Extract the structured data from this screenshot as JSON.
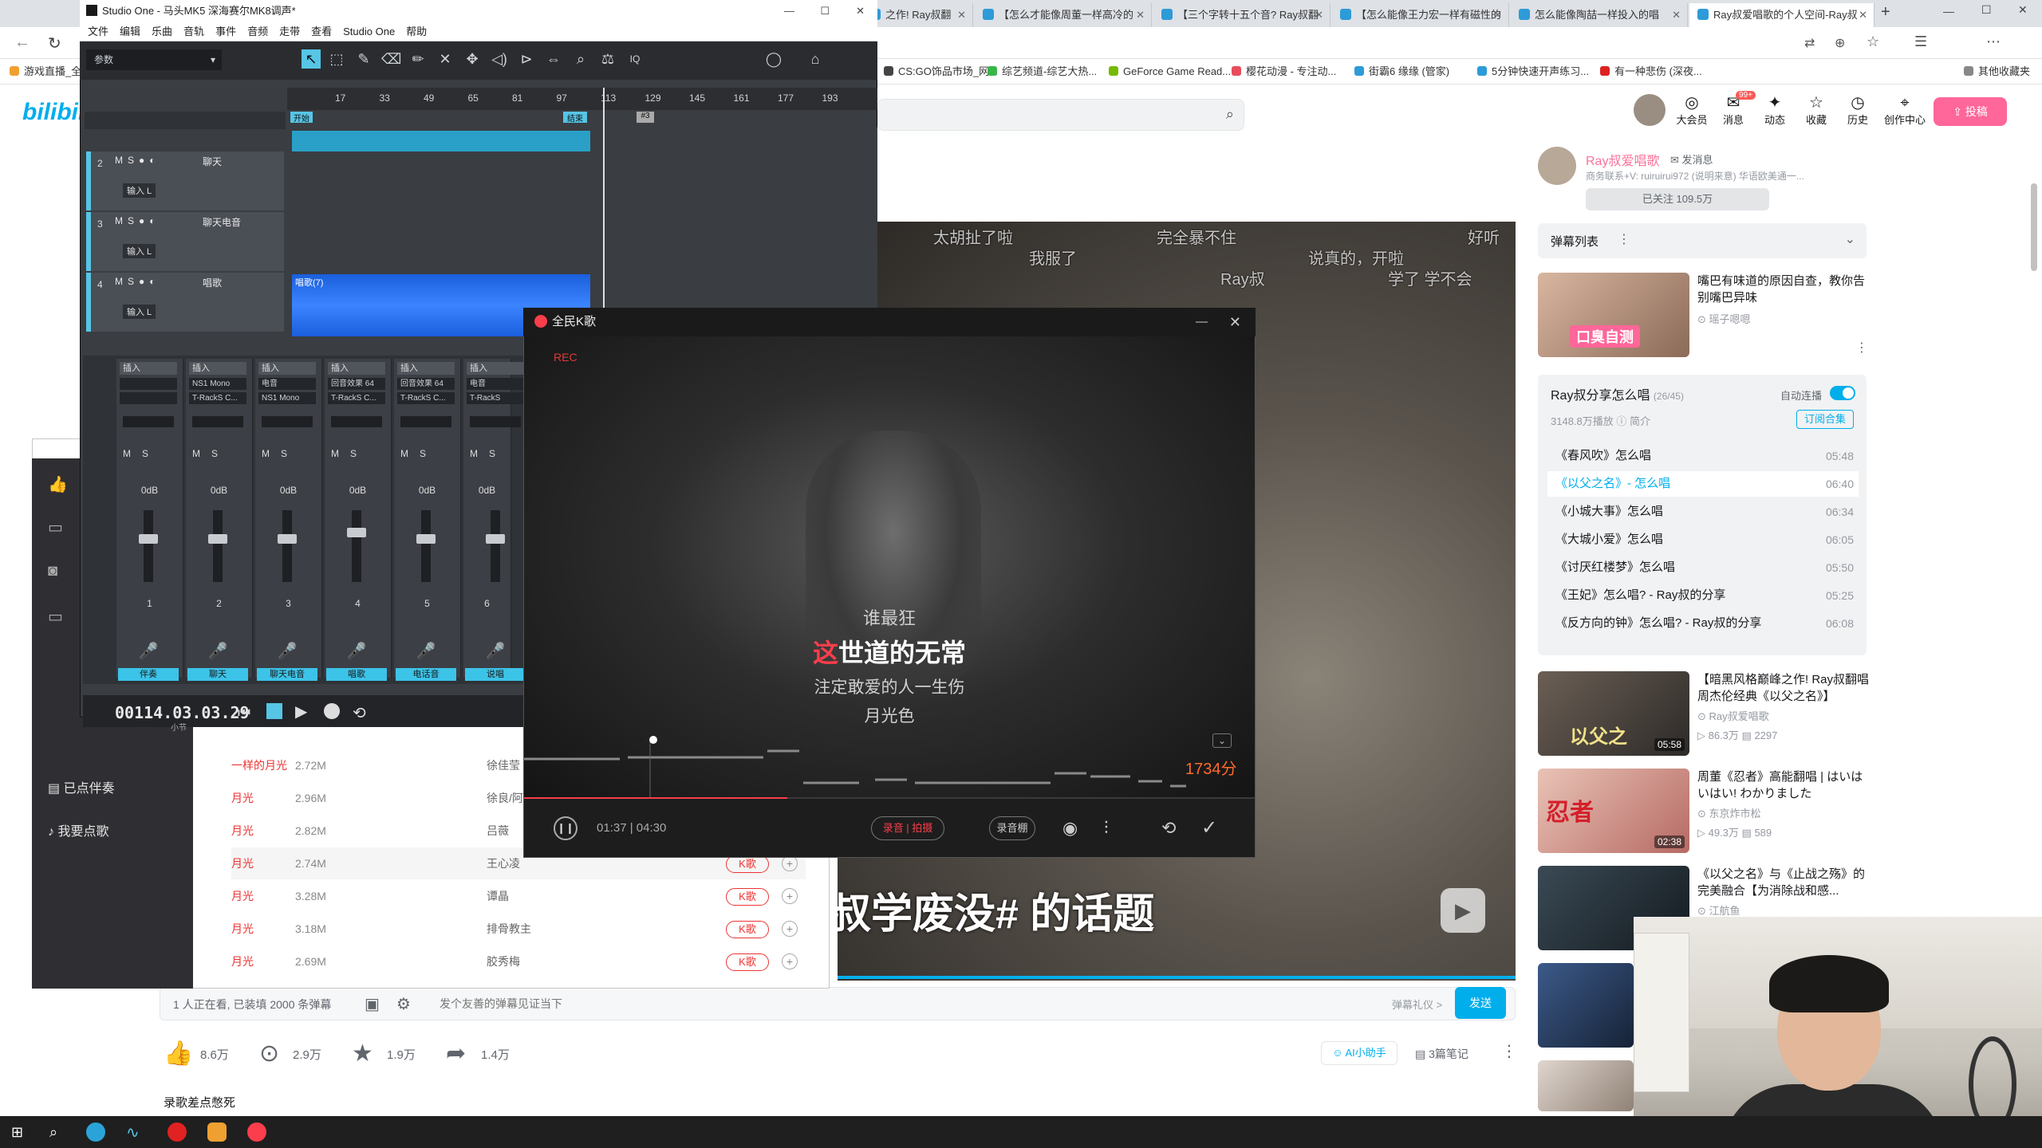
{
  "browser": {
    "tabs": [
      {
        "title": "之作! Ray叔翻"
      },
      {
        "title": "【怎么才能像周董一样高冷的"
      },
      {
        "title": "【三个字转十五个音? Ray叔翻"
      },
      {
        "title": "【怎么能像王力宏一样有磁性的"
      },
      {
        "title": "怎么能像陶喆一样投入的唱"
      },
      {
        "title": "Ray叔爱唱歌的个人空间-Ray叔"
      }
    ],
    "bookmarks": [
      "游戏直播_全",
      "CS:GO饰品市场_网...",
      "综艺频道-综艺大热...",
      "GeForce Game Read...",
      "樱花动漫 - 专注动...",
      "街霸6 缘缘 (管家)",
      "5分钟快速开声练习...",
      "有一种悲伤 (深夜...",
      "其他收藏夹"
    ]
  },
  "bilibili": {
    "logo": "bilibili",
    "header_icons": [
      {
        "label": "大会员",
        "glyph": "◎"
      },
      {
        "label": "消息",
        "glyph": "✉",
        "badge": "99+"
      },
      {
        "label": "动态",
        "glyph": "✦"
      },
      {
        "label": "收藏",
        "glyph": "☆"
      },
      {
        "label": "历史",
        "glyph": "◷"
      },
      {
        "label": "创作中心",
        "glyph": "⌖"
      }
    ],
    "upload_label": "投稿",
    "up": {
      "name": "Ray叔爱唱歌",
      "message": "发消息",
      "desc": "商务联系+V: ruiruirui972 (说明来意) 华语欧美通一...",
      "follow": "已关注 109.5万"
    },
    "danmaku_list_label": "弹幕列表",
    "ad": {
      "title": "嘴巴有味道的原因自查，教你告别嘴巴异味",
      "uploader": "瑶子嗯嗯",
      "thumb_text": "口臭自测"
    },
    "playlist": {
      "title": "Ray叔分享怎么唱",
      "count": "(26/45)",
      "plays": "3148.8万播放",
      "intro": "简介",
      "autoplay": "自动连播",
      "subscribe": "订阅合集",
      "items": [
        {
          "title": "《春风吹》怎么唱",
          "dur": "05:48"
        },
        {
          "title": "《以父之名》- 怎么唱",
          "dur": "06:40"
        },
        {
          "title": "《小城大事》怎么唱",
          "dur": "06:34"
        },
        {
          "title": "《大城小爱》怎么唱",
          "dur": "06:05"
        },
        {
          "title": "《讨厌红楼梦》怎么唱",
          "dur": "05:50"
        },
        {
          "title": "《王妃》怎么唱? - Ray叔的分享",
          "dur": "05:25"
        },
        {
          "title": "《反方向的钟》怎么唱? - Ray叔的分享",
          "dur": "06:08"
        }
      ]
    },
    "recs": [
      {
        "title": "【暗黑风格巅峰之作! Ray叔翻唱周杰伦经典《以父之名》】",
        "up": "Ray叔爱唱歌",
        "plays": "86.3万",
        "danmaku": "2297",
        "dur": "05:58",
        "thumb_text": "以父之"
      },
      {
        "title": "周董《忍者》高能翻唱 | はいはいはい! わかりました",
        "up": "东京炸市松",
        "plays": "49.3万",
        "danmaku": "589",
        "dur": "02:38",
        "thumb_text": "忍者"
      },
      {
        "title": "《以父之名》与《止战之殇》的完美融合【为消除战和感...",
        "up": "江航鱼"
      }
    ],
    "video": {
      "danmaku": [
        "太胡扯了啦",
        "完全暴不住",
        "我服了",
        "说真的，开啦",
        "学了 学不会",
        "Ray叔",
        "好听"
      ],
      "subtitle": "叔学废没# 的话题"
    },
    "danmaku_bar": {
      "watching": "1 人正在看, 已装填 2000 条弹幕",
      "placeholder": "发个友善的弹幕见证当下",
      "etiquette": "弹幕礼仪 >",
      "send": "发送"
    },
    "actions": {
      "like": "8.6万",
      "coin": "2.9万",
      "fav": "1.9万",
      "share": "1.4万",
      "ai": "AI小助手",
      "notes": "3篇笔记"
    },
    "below_text": "录歌差点憋死"
  },
  "karaoke_bg": {
    "sidebar": [
      "已点伴奏",
      "我要点歌"
    ],
    "songs": [
      {
        "title": "一样的月光",
        "size": "2.72M",
        "artist": "徐佳莹"
      },
      {
        "title": "月光",
        "size": "2.96M",
        "artist": "徐良/阿..."
      },
      {
        "title": "月光",
        "size": "2.82M",
        "artist": "吕薇"
      },
      {
        "title": "月光",
        "size": "2.74M",
        "artist": "王心凌",
        "k": "K歌"
      },
      {
        "title": "月光",
        "size": "3.28M",
        "artist": "谭晶",
        "k": "K歌"
      },
      {
        "title": "月光",
        "size": "3.18M",
        "artist": "排骨教主",
        "k": "K歌"
      },
      {
        "title": "月光",
        "size": "2.69M",
        "artist": "胶秀梅",
        "k": "K歌"
      }
    ]
  },
  "daw": {
    "title": "Studio One - 马头MK5 深海赛尔MK8调声*",
    "menu": [
      "文件",
      "编辑",
      "乐曲",
      "音轨",
      "事件",
      "音频",
      "走带",
      "查看",
      "Studio One",
      "帮助"
    ],
    "preset": "参数",
    "ruler": [
      "17",
      "33",
      "49",
      "65",
      "81",
      "97",
      "113",
      "129",
      "145",
      "161",
      "177",
      "193"
    ],
    "marks": {
      "start": "开始",
      "end": "结束",
      "loop": "#3"
    },
    "tracks": [
      {
        "num": "2",
        "name": "聊天",
        "input": "输入 L"
      },
      {
        "num": "3",
        "name": "聊天电音",
        "input": "输入 L"
      },
      {
        "num": "4",
        "name": "唱歌",
        "input": "输入 L",
        "clip": "唱歌(7)"
      }
    ],
    "mixer": [
      {
        "ch": "1",
        "label": "伴奏",
        "slot1": "",
        "slot2": ""
      },
      {
        "ch": "2",
        "label": "聊天",
        "slot1": "NS1 Mono",
        "slot2": "T-RackS C..."
      },
      {
        "ch": "3",
        "label": "聊天电音",
        "slot1": "电音",
        "slot2": "NS1 Mono"
      },
      {
        "ch": "4",
        "label": "唱歌",
        "slot1": "回音效果 64",
        "slot2": "T-RackS C..."
      },
      {
        "ch": "5",
        "label": "电话音",
        "slot1": "回音效果 64",
        "slot2": "T-RackS C..."
      },
      {
        "ch": "6",
        "label": "说唱",
        "slot1": "电音",
        "slot2": "T-RackS"
      }
    ],
    "insert_label": "插入",
    "db": "0dB",
    "timecode": "00114.03.03.29",
    "timecode_unit": "小节"
  },
  "kplayer": {
    "title": "全民K歌",
    "rec": "REC",
    "lyrics": {
      "prev": "谁最狂",
      "current_hl": "这",
      "current_rest": "世道的无常",
      "next": "注定敢爱的人一生伤",
      "next2": "月光色"
    },
    "score": "1734分",
    "time": "01:37 | 04:30",
    "progress": 0.36,
    "btn_record": "录音 | 拍摄",
    "btn_studio": "录音棚"
  }
}
